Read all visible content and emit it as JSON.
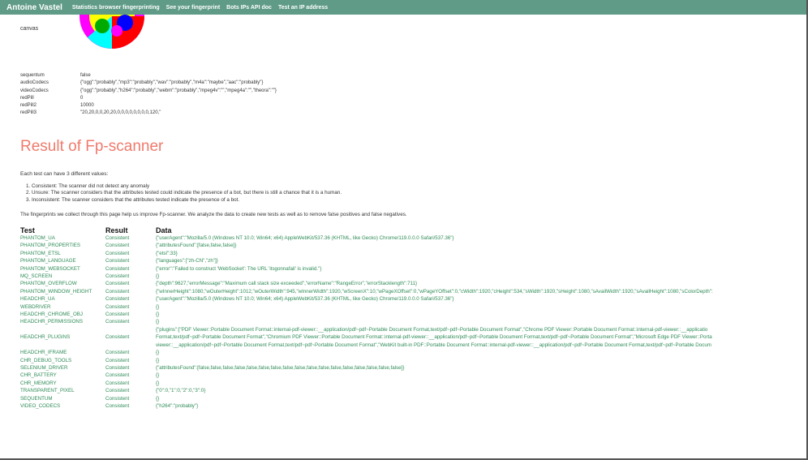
{
  "nav": {
    "brand": "Antoine Vastel",
    "links": [
      "Statistics browser fingerprinting",
      "See your fingerprint",
      "Bots IPs API doc",
      "Test an IP address"
    ]
  },
  "canvas_label": "canvas",
  "props": [
    {
      "key": "sequentum",
      "value": "false"
    },
    {
      "key": "audioCodecs",
      "value": "{\"ogg\":\"probably\",\"mp3\":\"probably\",\"wav\":\"probably\",\"m4a\":\"maybe\",\"aac\":\"probably\"}"
    },
    {
      "key": "videoCodecs",
      "value": "{\"ogg\":\"probably\",\"h264\":\"probably\",\"webm\":\"probably\",\"mpeg4v\":\"\",\"mpeg4a\":\"\",\"theora\":\"\"}"
    },
    {
      "key": "redPill",
      "value": "0"
    },
    {
      "key": "redPill2",
      "value": "10000"
    },
    {
      "key": "redPill3",
      "value": "\"20,20,0,0,20,20,0,0,0,0,0,0,0,0,120,\""
    }
  ],
  "result": {
    "title": "Result of Fp-scanner",
    "intro": "Each test can have 3 different values:",
    "rules": [
      "Consistent: The scanner did not detect any anomaly",
      "Unsure: The scanner considers that the attributes tested could indicate the presence of a bot, but there is still a chance that it is a human.",
      "Inconsistent: The scanner considers that the attributes tested indicate the presence of a bot."
    ],
    "note": "The fingerprints we collect through this page help us improve Fp-scanner. We analyze the data to create new tests as well as to remove false positives and false negatives."
  },
  "table": {
    "headers": {
      "test": "Test",
      "result": "Result",
      "data": "Data"
    },
    "rows": [
      {
        "test": "PHANTOM_UA",
        "result": "Consistent",
        "data": "{\"userAgent\":\"Mozilla/5.0 (Windows NT 10.0; Win64; x64) AppleWebKit/537.36 (KHTML, like Gecko) Chrome/119.0.0.0 Safari/537.36\"}"
      },
      {
        "test": "PHANTOM_PROPERTIES",
        "result": "Consistent",
        "data": "{\"attributesFound\":[false,false,false]}"
      },
      {
        "test": "PHANTOM_ETSL",
        "result": "Consistent",
        "data": "{\"etsl\":33}"
      },
      {
        "test": "PHANTOM_LANGUAGE",
        "result": "Consistent",
        "data": "{\"languages\":[\"zh-CN\",\"zh\"]}"
      },
      {
        "test": "PHANTOM_WEBSOCKET",
        "result": "Consistent",
        "data": "{\"error\":\"Failed to construct 'WebSocket': The URL 'itsgonnafail' is invalid.\"}"
      },
      {
        "test": "MQ_SCREEN",
        "result": "Consistent",
        "data": "{}"
      },
      {
        "test": "PHANTOM_OVERFLOW",
        "result": "Consistent",
        "data": "{\"depth\":9627,\"errorMessage\":\"Maximum call stack size exceeded\",\"errorName\":\"RangeError\",\"errorStacklength\":711}"
      },
      {
        "test": "PHANTOM_WINDOW_HEIGHT",
        "result": "Consistent",
        "data": "{\"wInnerHeight\":1080,\"wOuterHeight\":1012,\"wOuterWidth\":945,\"wInnerWidth\":1920,\"wScreenX\":10,\"wPageXOffset\":0,\"wPageYOffset\":0,\"cWidth\":1920,\"cHeight\":534,\"sWidth\":1920,\"sHeight\":1080,\"sAvailWidth\":1920,\"sAvailHeight\":1080,\"sColorDepth\":"
      },
      {
        "test": "HEADCHR_UA",
        "result": "Consistent",
        "data": "{\"userAgent\":\"Mozilla/5.0 (Windows NT 10.0; Win64; x64) AppleWebKit/537.36 (KHTML, like Gecko) Chrome/119.0.0.0 Safari/537.36\"}"
      },
      {
        "test": "WEBDRIVER",
        "result": "Consistent",
        "data": "{}"
      },
      {
        "test": "HEADCHR_CHROME_OBJ",
        "result": "Consistent",
        "data": "{}"
      },
      {
        "test": "HEADCHR_PERMISSIONS",
        "result": "Consistent",
        "data": "{}"
      },
      {
        "test": "HEADCHR_PLUGINS",
        "result": "Consistent",
        "data_lines": [
          "{\"plugins\":[\"PDF Viewer::Portable Document Format::internal-pdf-viewer::__application/pdf~pdf~Portable Document Format,text/pdf~pdf~Portable Document Format\",\"Chrome PDF Viewer::Portable Document Format::internal-pdf-viewer::__applicatio",
          "Format,text/pdf~pdf~Portable Document Format\",\"Chromium PDF Viewer::Portable Document Format::internal-pdf-viewer::__application/pdf~pdf~Portable Document Format,text/pdf~pdf~Portable Document Format\",\"Microsoft Edge PDF Viewer::Porta",
          "viewer::__application/pdf~pdf~Portable Document Format,text/pdf~pdf~Portable Document Format\",\"WebKit built-in PDF::Portable Document Format::internal-pdf-viewer::__application/pdf~pdf~Portable Document Format,text/pdf~pdf~Portable Docum"
        ]
      },
      {
        "test": "HEADCHR_IFRAME",
        "result": "Consistent",
        "data": "{}"
      },
      {
        "test": "CHR_DEBUG_TOOLS",
        "result": "Consistent",
        "data": "{}"
      },
      {
        "test": "SELENIUM_DRIVER",
        "result": "Consistent",
        "data": "{\"attributesFound\":[false,false,false,false,false,false,false,false,false,false,false,false,false,false,false,false,false]}"
      },
      {
        "test": "CHR_BATTERY",
        "result": "Consistent",
        "data": "{}"
      },
      {
        "test": "CHR_MEMORY",
        "result": "Consistent",
        "data": "{}"
      },
      {
        "test": "TRANSPARENT_PIXEL",
        "result": "Consistent",
        "data": "{\"0\":0,\"1\":0,\"2\":0,\"3\":0}"
      },
      {
        "test": "SEQUENTUM",
        "result": "Consistent",
        "data": "{}"
      },
      {
        "test": "VIDEO_CODECS",
        "result": "Consistent",
        "data": "{\"h264\":\"probably\"}"
      }
    ]
  }
}
